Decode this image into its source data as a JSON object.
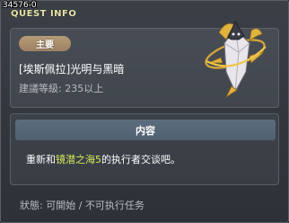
{
  "window": {
    "quest_id": "34576-0",
    "title": "QUEST INFO"
  },
  "quest": {
    "category_badge": "主要",
    "name": "[埃斯佩拉]光明与黑暗",
    "level_requirement": "建議等級: 235以上"
  },
  "content": {
    "header": "内容",
    "text_before": "重新和",
    "text_highlight": "镜潜之海5",
    "text_after": "的执行者交谈吧。"
  },
  "status": {
    "text": "狀態:  可開始 / 不可执行任务"
  },
  "icons": {
    "emblem": "winged-crystal-emblem-icon"
  },
  "colors": {
    "highlight": "#d8e85c",
    "badge": "#b69b78",
    "header_bar": "#5c6e7e"
  }
}
